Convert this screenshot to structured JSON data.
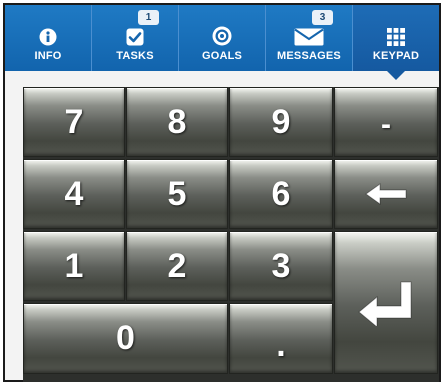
{
  "tabs": [
    {
      "id": "info",
      "label": "INFO",
      "icon": "info-icon",
      "badge": null,
      "active": false
    },
    {
      "id": "tasks",
      "label": "TASKS",
      "icon": "checkbox-icon",
      "badge": "1",
      "active": false
    },
    {
      "id": "goals",
      "label": "GOALS",
      "icon": "target-icon",
      "badge": null,
      "active": false
    },
    {
      "id": "messages",
      "label": "MESSAGES",
      "icon": "envelope-icon",
      "badge": "3",
      "active": false
    },
    {
      "id": "keypad",
      "label": "KEYPAD",
      "icon": "keypad-grid-icon",
      "badge": null,
      "active": true
    }
  ],
  "keypad": {
    "k7": "7",
    "k8": "8",
    "k9": "9",
    "minus": "-",
    "k4": "4",
    "k5": "5",
    "k6": "6",
    "k1": "1",
    "k2": "2",
    "k3": "3",
    "k0": "0",
    "dot": ".",
    "backspace_icon": "backspace-arrow-icon",
    "enter_icon": "enter-return-icon"
  },
  "colors": {
    "tab_bar": "#1d6fbb",
    "badge_bg": "#eaf1f8",
    "key_text": "#ffffff"
  }
}
